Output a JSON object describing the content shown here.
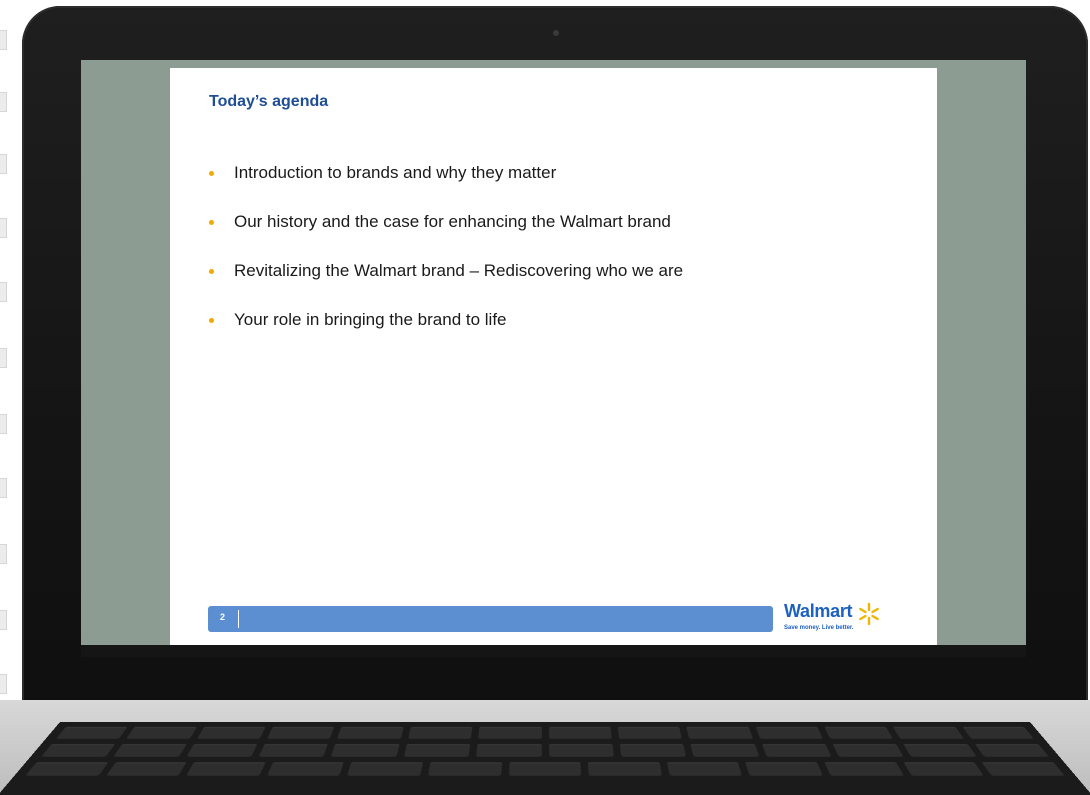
{
  "slide": {
    "title": "Today’s agenda",
    "agenda": [
      "Introduction to brands and why they matter",
      "Our history and the case for enhancing the Walmart brand",
      "Revitalizing the Walmart brand – Rediscovering who we are",
      "Your role in bringing the brand to life"
    ],
    "page_number": "2",
    "brand": {
      "name": "Walmart",
      "tagline": "Save money. Live better.",
      "icon": "spark-icon"
    }
  },
  "colors": {
    "title": "#1f4e96",
    "bullet": "#f2a900",
    "footer_bar": "#5b8fd1",
    "brand_blue": "#1d61c1",
    "brand_spark": "#f2b500",
    "screen_background": "#8c9c92"
  }
}
